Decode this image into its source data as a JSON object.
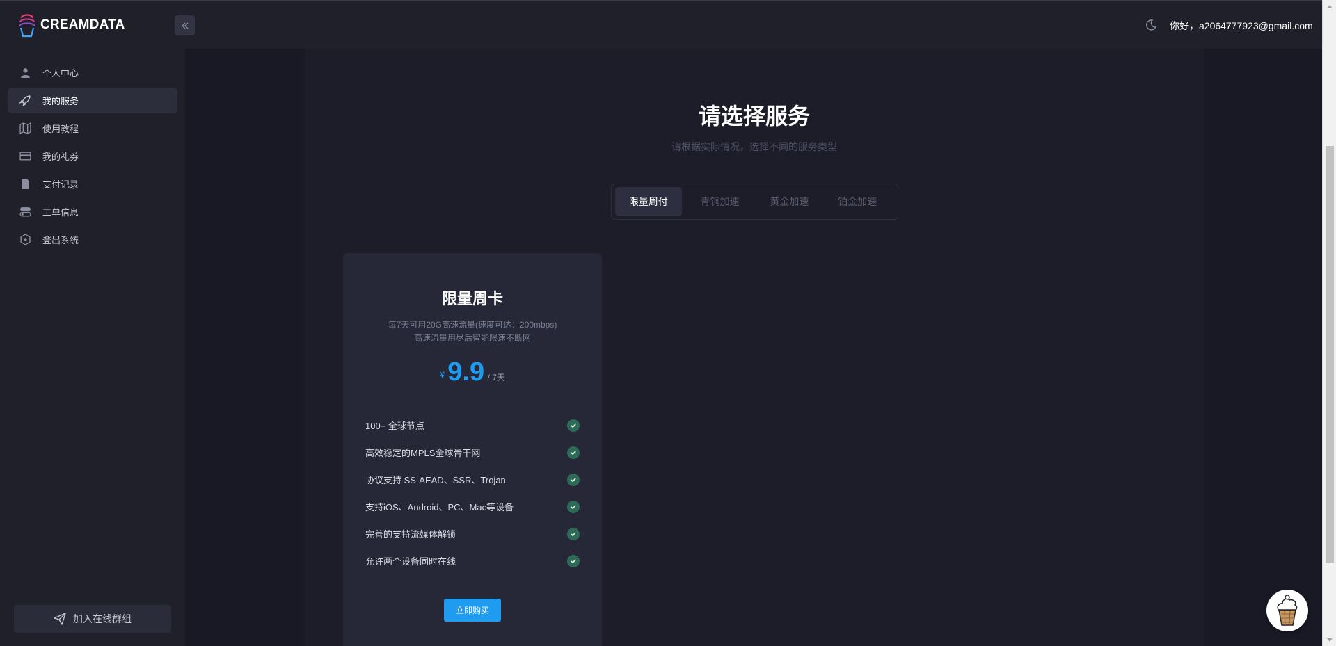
{
  "brand": {
    "name": "CREAMDATA"
  },
  "header": {
    "greeting": "你好，a2064777923@gmail.com"
  },
  "sidebar": {
    "items": [
      {
        "label": "个人中心",
        "icon": "user-icon",
        "active": false
      },
      {
        "label": "我的服务",
        "icon": "rocket-icon",
        "active": true
      },
      {
        "label": "使用教程",
        "icon": "map-icon",
        "active": false
      },
      {
        "label": "我的礼券",
        "icon": "card-icon",
        "active": false
      },
      {
        "label": "支付记录",
        "icon": "file-icon",
        "active": false
      },
      {
        "label": "工单信息",
        "icon": "toggle-icon",
        "active": false
      },
      {
        "label": "登出系统",
        "icon": "hexagon-icon",
        "active": false
      }
    ],
    "join_label": "加入在线群组"
  },
  "main": {
    "title": "请选择服务",
    "subtitle": "请根据实际情况，选择不同的服务类型",
    "tabs": [
      {
        "label": "限量周付",
        "active": true
      },
      {
        "label": "青铜加速",
        "active": false
      },
      {
        "label": "黄金加速",
        "active": false
      },
      {
        "label": "铂金加速",
        "active": false
      }
    ],
    "card": {
      "title": "限量周卡",
      "desc_line1": "每7天可用20G高速流量(速度可达：200mbps)",
      "desc_line2": "高速流量用尽后智能限速不断网",
      "currency": "¥",
      "price": "9.9",
      "unit": "/ 7天",
      "features": [
        "100+ 全球节点",
        "高效稳定的MPLS全球骨干网",
        "协议支持 SS-AEAD、SSR、Trojan",
        "支持iOS、Android、PC、Mac等设备",
        "完善的支持流媒体解锁",
        "允许两个设备同时在线"
      ],
      "buy_label": "立即购买"
    }
  },
  "colors": {
    "accent": "#1f9cf0",
    "check": "#2e6b57",
    "sidebar_bg": "#1f2029",
    "content_bg": "#1c1d29",
    "card_bg": "#262838"
  }
}
